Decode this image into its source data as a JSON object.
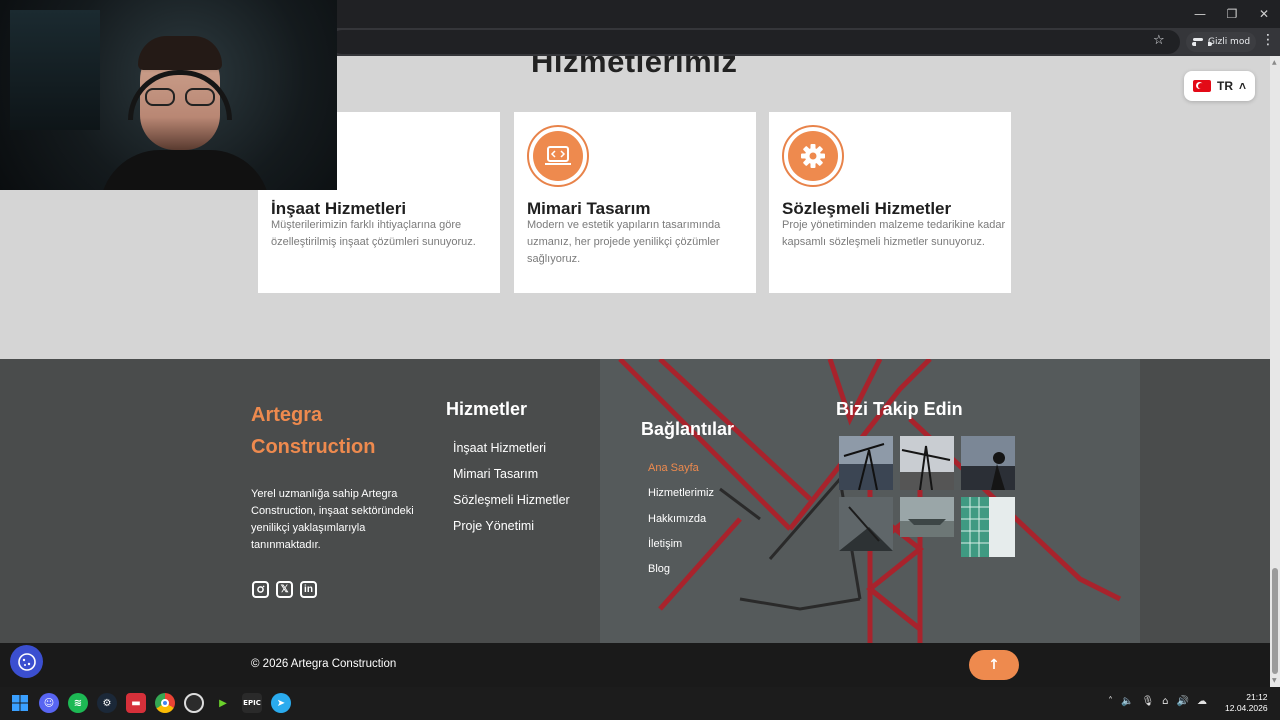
{
  "browser": {
    "mode_label": "Gizli mod",
    "window_controls": [
      "minimize-icon",
      "restore-icon",
      "close-icon"
    ]
  },
  "page": {
    "section_title": "Hizmetlerimiz",
    "language": {
      "code": "TR",
      "flag": "turkey-flag-icon"
    },
    "services": [
      {
        "title": "İnşaat Hizmetleri",
        "description": "Müşterilerimizin farklı ihtiyaçlarına göre özelleştirilmiş inşaat çözümleri sunuyoruz.",
        "icon": "construction-icon"
      },
      {
        "title": "Mimari Tasarım",
        "description": "Modern ve estetik yapıların tasarımında uzmanız, her projede yenilikçi çözümler sağlıyoruz.",
        "icon": "laptop-code-icon"
      },
      {
        "title": "Sözleşmeli Hizmetler",
        "description": "Proje yönetiminden malzeme tedarikine kadar kapsamlı sözleşmeli hizmetler sunuyoruz.",
        "icon": "gear-icon"
      }
    ]
  },
  "footer": {
    "brand_line1": "Artegra",
    "brand_line2": "Construction",
    "about": "Yerel uzmanlığa sahip Artegra Construction, inşaat sektöründeki yenilikçi yaklaşımlarıyla tanınmaktadır.",
    "social": [
      "instagram-icon",
      "x-icon",
      "linkedin-icon"
    ],
    "services_title": "Hizmetler",
    "services": [
      "İnşaat Hizmetleri",
      "Mimari Tasarım",
      "Sözleşmeli Hizmetler",
      "Proje Yönetimi"
    ],
    "links_title": "Bağlantılar",
    "links": [
      "Ana Sayfa",
      "Hizmetlerimiz",
      "Hakkımızda",
      "İletişim",
      "Blog"
    ],
    "follow_title": "Bizi Takip Edin",
    "copyright": "© 2026 Artegra Construction",
    "accent_color": "#ee8a4e"
  },
  "taskbar": {
    "time": "21:12",
    "date": "12.04.2026",
    "apps": [
      "windows-start-icon",
      "discord-icon",
      "spotify-icon",
      "steam-icon",
      "app-red-icon",
      "chrome-icon",
      "obs-icon",
      "app-green-icon",
      "epic-games-icon",
      "telegram-icon"
    ]
  }
}
